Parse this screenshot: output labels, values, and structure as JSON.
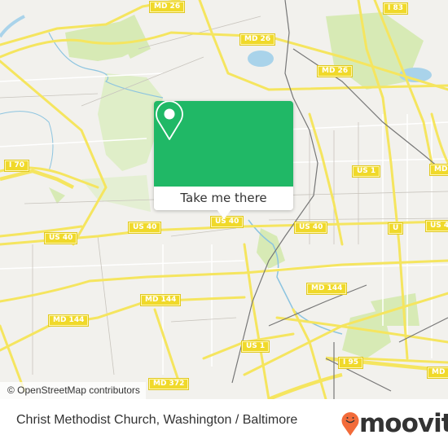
{
  "map": {
    "attribution": "© OpenStreetMap contributors",
    "colors": {
      "background": "#f2f1ed",
      "road": "#f5e55f",
      "park": "#d7eab5",
      "water": "#a9d3ea",
      "rail": "#777777"
    },
    "shields": [
      {
        "label": "MD 26",
        "id": "md26-top"
      },
      {
        "label": "I 83",
        "id": "i83"
      },
      {
        "label": "MD 26",
        "id": "md26-mid"
      },
      {
        "label": "MD 26",
        "id": "md26-right"
      },
      {
        "label": "I 70",
        "id": "i70"
      },
      {
        "label": "US 1",
        "id": "us1-top"
      },
      {
        "label": "MD",
        "id": "md-right"
      },
      {
        "label": "US 40",
        "id": "us40-left"
      },
      {
        "label": "US 40",
        "id": "us40-midleft"
      },
      {
        "label": "US 40",
        "id": "us40-center"
      },
      {
        "label": "US 40",
        "id": "us40-centerright"
      },
      {
        "label": "U",
        "id": "u-right"
      },
      {
        "label": "US 4",
        "id": "us4-right"
      },
      {
        "label": "MD 144",
        "id": "md144-right"
      },
      {
        "label": "MD 144",
        "id": "md144-center"
      },
      {
        "label": "MD 144",
        "id": "md144-left"
      },
      {
        "label": "US 1",
        "id": "us1-bottom"
      },
      {
        "label": "I 95",
        "id": "i95"
      },
      {
        "label": "MD",
        "id": "md-bottomright"
      },
      {
        "label": "MD 372",
        "id": "md372"
      }
    ]
  },
  "popup": {
    "button_label": "Take me there",
    "color": "#20b866",
    "icon": "map-pin-icon"
  },
  "footer": {
    "title": "Christ Methodist Church, Washington / Baltimore",
    "logo_text": "moovit",
    "logo_icon": "moovit-pin-smile-icon",
    "logo_color": "#f26b3a"
  }
}
